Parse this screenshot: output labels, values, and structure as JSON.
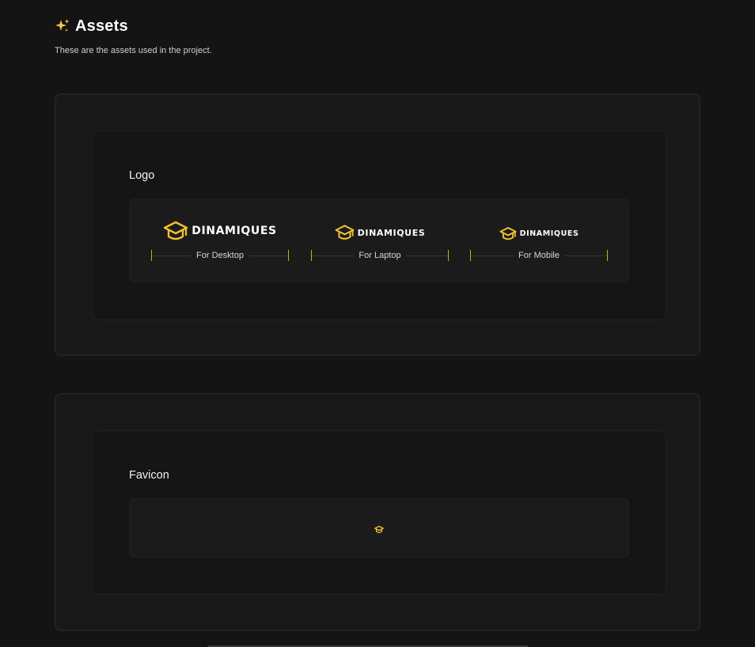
{
  "header": {
    "icon": "sparkles-icon",
    "title": "Assets",
    "subtitle": "These are the assets used in the project."
  },
  "colors": {
    "background": "#141414",
    "accent": "#F2C230",
    "measure_tick": "#D4A42C"
  },
  "logo_section": {
    "label": "Logo",
    "brand_name": "DINAMIQUES",
    "variants": [
      {
        "caption": "For Desktop",
        "icon": "graduation-cap-icon"
      },
      {
        "caption": "For Laptop",
        "icon": "graduation-cap-icon"
      },
      {
        "caption": "For Mobile",
        "icon": "graduation-cap-icon"
      }
    ]
  },
  "favicon_section": {
    "label": "Favicon",
    "icon": "graduation-cap-icon"
  }
}
